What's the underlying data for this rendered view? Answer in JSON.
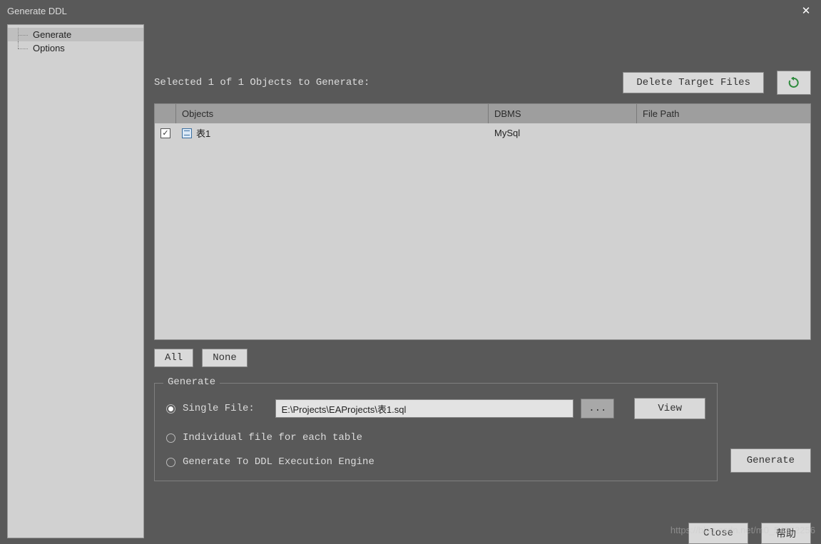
{
  "window": {
    "title": "Generate DDL"
  },
  "sidebar": {
    "items": [
      {
        "label": "Generate",
        "selected": true
      },
      {
        "label": "Options",
        "selected": false
      }
    ]
  },
  "status": {
    "text": "Selected  1 of 1  Objects to Generate:"
  },
  "buttons": {
    "delete_target": "Delete Target Files",
    "all": "All",
    "none": "None",
    "browse": "...",
    "view": "View",
    "generate": "Generate",
    "close": "Close",
    "help": "帮助"
  },
  "table": {
    "headers": {
      "objects": "Objects",
      "dbms": "DBMS",
      "file_path": "File Path"
    },
    "rows": [
      {
        "checked": true,
        "name": "表1",
        "dbms": "MySql",
        "path": ""
      }
    ]
  },
  "generate_group": {
    "legend": "Generate",
    "options": {
      "single_file": "Single File:",
      "individual": "Individual file for each table",
      "engine": "Generate To DDL Execution Engine"
    },
    "selected": "single_file",
    "path_value": "E:\\Projects\\EAProjects\\表1.sql"
  },
  "watermark": "https://blog.csdn.net/m0_54852256"
}
